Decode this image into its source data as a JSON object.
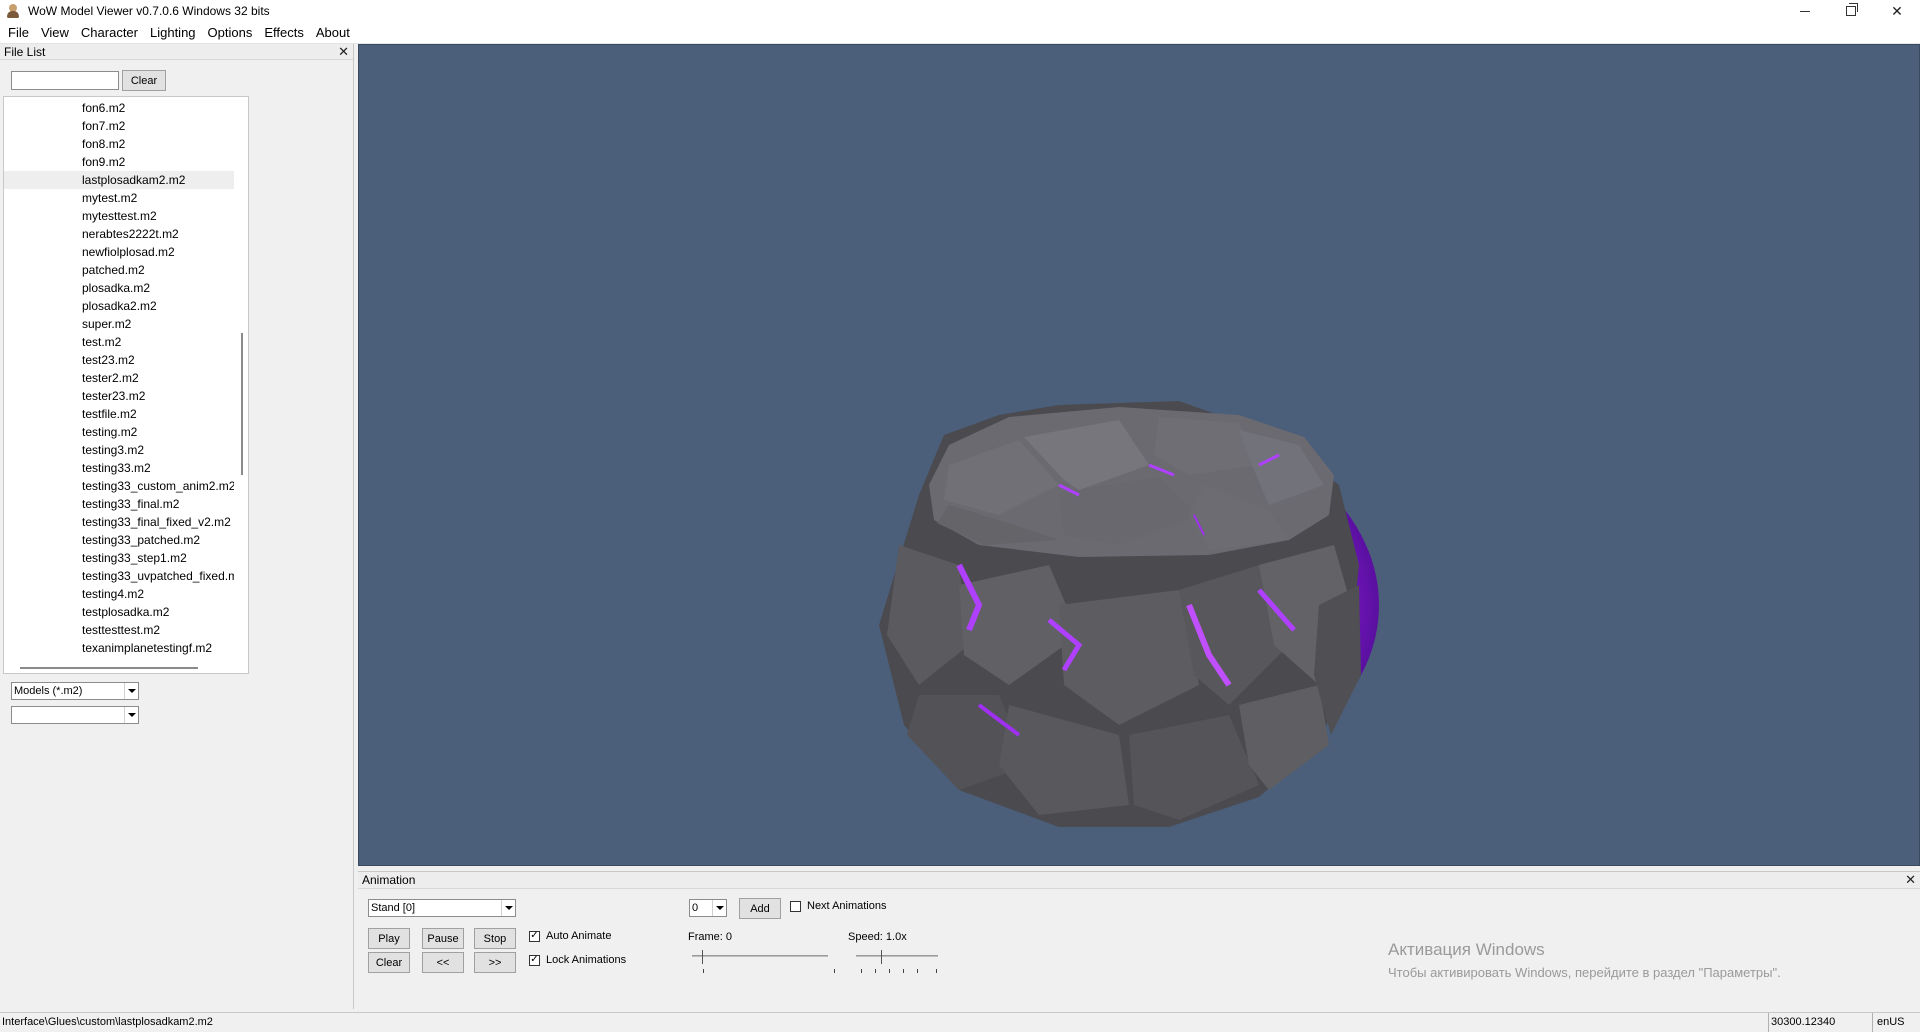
{
  "window": {
    "title": "WoW Model Viewer v0.7.0.6 Windows 32 bits",
    "controls": [
      "minimize",
      "maximize",
      "close"
    ]
  },
  "menu": [
    "File",
    "View",
    "Character",
    "Lighting",
    "Options",
    "Effects",
    "About"
  ],
  "file_list": {
    "caption": "File List",
    "search_value": "",
    "clear_label": "Clear",
    "files": [
      "fon6.m2",
      "fon7.m2",
      "fon8.m2",
      "fon9.m2",
      "lastplosadkam2.m2",
      "mytest.m2",
      "mytesttest.m2",
      "nerabtes2222t.m2",
      "newfiolplosad.m2",
      "patched.m2",
      "plosadka.m2",
      "plosadka2.m2",
      "super.m2",
      "test.m2",
      "test23.m2",
      "tester2.m2",
      "tester23.m2",
      "testfile.m2",
      "testing.m2",
      "testing3.m2",
      "testing33.m2",
      "testing33_custom_anim2.m2",
      "testing33_final.m2",
      "testing33_final_fixed_v2.m2",
      "testing33_patched.m2",
      "testing33_step1.m2",
      "testing33_uvpatched_fixed.m",
      "testing4.m2",
      "testplosadka.m2",
      "testtesttest.m2",
      "texanimplanetestingf.m2"
    ],
    "selected_file": "lastplosadkam2.m2",
    "filter_value": "Models (*.m2)",
    "second_filter_value": ""
  },
  "animation": {
    "caption": "Animation",
    "animation_select": "Stand [0]",
    "play_label": "Play",
    "pause_label": "Pause",
    "stop_label": "Stop",
    "clear_label": "Clear",
    "prev_label": "<<",
    "next_label": ">>",
    "auto_animate_label": "Auto Animate",
    "auto_animate_checked": true,
    "lock_animations_label": "Lock Animations",
    "lock_animations_checked": true,
    "next_anim_select": "0",
    "add_label": "Add",
    "next_animations_label": "Next Animations",
    "next_animations_checked": false,
    "frame_label": "Frame: 0",
    "speed_label": "Speed: 1.0x"
  },
  "watermark": {
    "title": "Активация Windows",
    "subtitle": "Чтобы активировать Windows, перейдите в раздел \"Параметры\"."
  },
  "status_bar": {
    "path": "Interface\\Glues\\custom\\lastplosadkam2.m2",
    "version": "30300.12340",
    "locale": "enUS"
  },
  "colors": {
    "viewport_bg": "#4b5f7b",
    "rock": "#5a5a5e",
    "glow": "#a020f0"
  }
}
